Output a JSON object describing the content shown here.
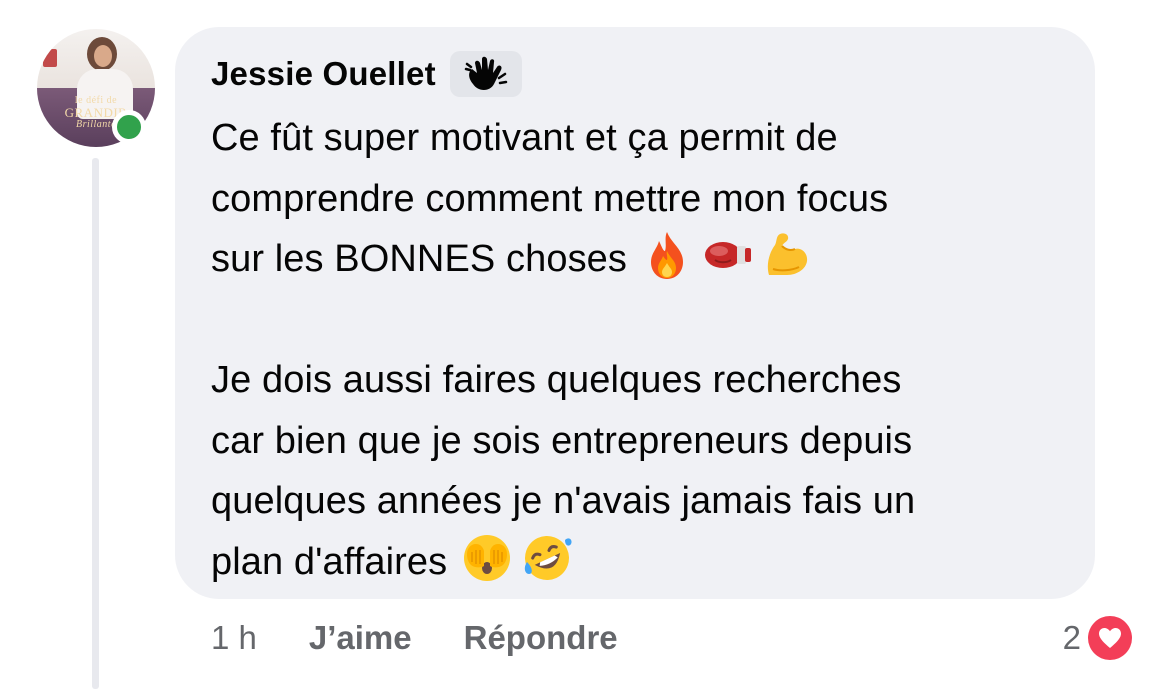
{
  "comment": {
    "author": "Jessie Ouellet",
    "badge_icon": "waving-hand-icon",
    "avatar_text_line1": "le défi de",
    "avatar_text_line2": "GRANDIR",
    "avatar_text_line3": "Brillante",
    "paragraphs": [
      {
        "lines": [
          "Ce fût super motivant et ça permit de",
          "comprendre comment mettre mon focus"
        ],
        "last_line": "sur les BONNES choses",
        "emojis": [
          "fire-emoji",
          "boxing-glove-emoji",
          "flexed-biceps-emoji"
        ]
      },
      {
        "lines": [
          "Je dois aussi faires quelques recherches",
          "car bien que je sois entrepreneurs depuis",
          "quelques années je n'avais jamais fais un"
        ],
        "last_line": "plan d'affaires",
        "emojis": [
          "face-with-hands-over-eyes-emoji",
          "rolling-on-floor-laughing-emoji"
        ]
      }
    ]
  },
  "actions": {
    "timestamp": "1 h",
    "like_label": "J’aime",
    "reply_label": "Répondre"
  },
  "reactions": {
    "count": "2",
    "icon": "heart-icon"
  },
  "colors": {
    "bubble": "#f0f1f5",
    "online": "#31a24c",
    "heart": "#f33e58",
    "secondary_text": "#65676b"
  }
}
